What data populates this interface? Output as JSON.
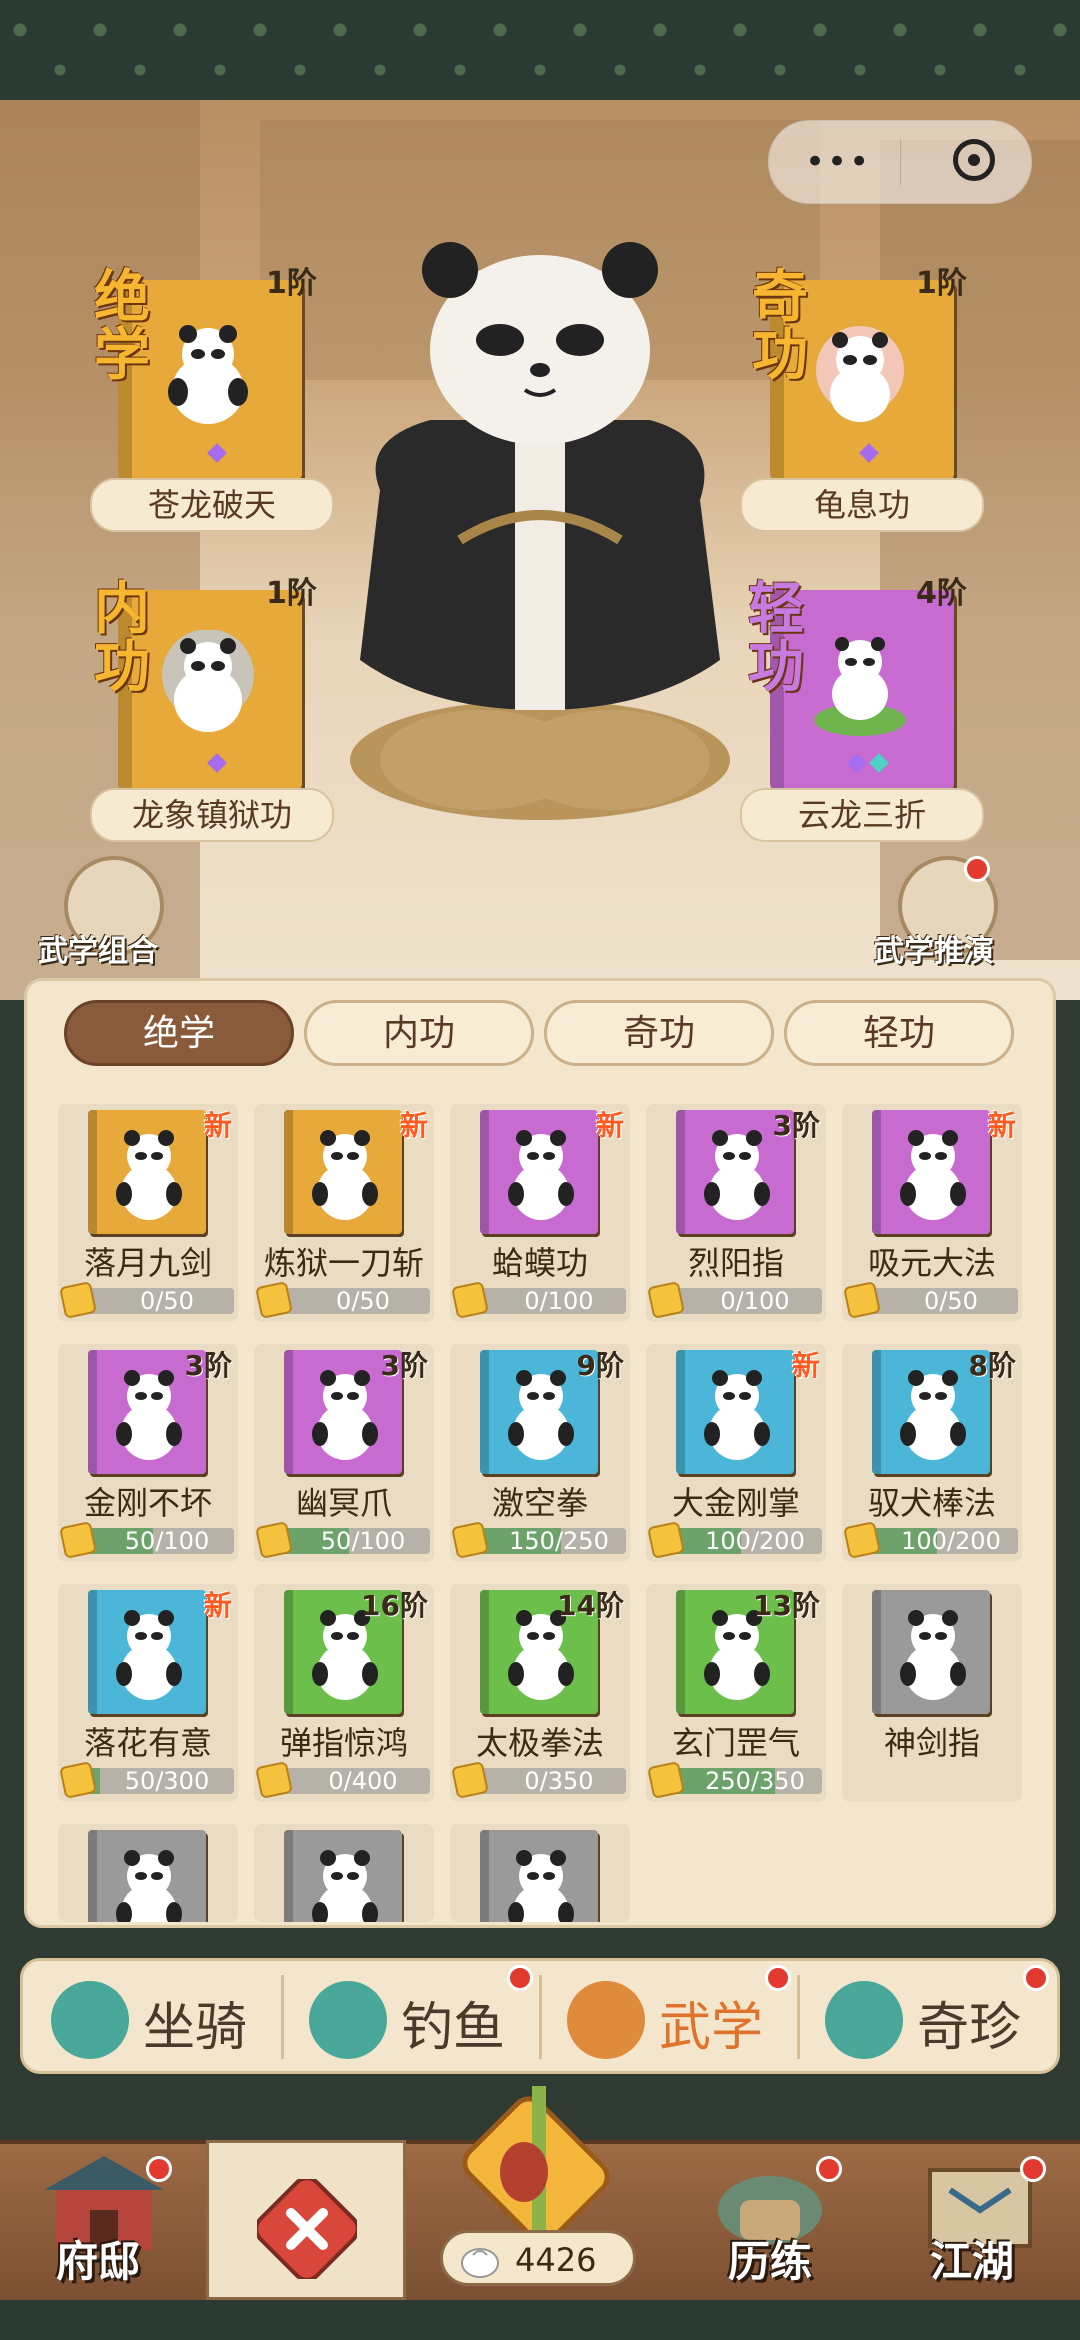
{
  "header": {
    "menu_label": "•••",
    "colors": {
      "band": "#2b3a33",
      "active_tab": "#8a5b3a",
      "new_tag": "#ff5a1f"
    }
  },
  "equipped": [
    {
      "category": "绝学",
      "name": "苍龙破天",
      "tier": "1阶",
      "color": "#e6a93a",
      "gems": [
        "#a66cf0"
      ]
    },
    {
      "category": "奇功",
      "name": "龟息功",
      "tier": "1阶",
      "color": "#e6a93a",
      "gems": [
        "#a66cf0"
      ]
    },
    {
      "category": "内功",
      "name": "龙象镇狱功",
      "tier": "1阶",
      "color": "#e6a93a",
      "gems": [
        "#a66cf0"
      ]
    },
    {
      "category": "轻功",
      "name": "云龙三折",
      "tier": "4阶",
      "color": "#c76bd1",
      "gems": [
        "#a66cf0",
        "#4fd1c5"
      ]
    }
  ],
  "side_buttons": {
    "combo": "武学组合",
    "deduce": "武学推演"
  },
  "tabs": [
    "绝学",
    "内功",
    "奇功",
    "轻功"
  ],
  "active_tab": 0,
  "skills": [
    {
      "name": "落月九剑",
      "tag": "新",
      "tag_type": "new",
      "progress": "0/50",
      "fill": 0.0,
      "color": "#e6a93a"
    },
    {
      "name": "炼狱一刀斩",
      "tag": "新",
      "tag_type": "new",
      "progress": "0/50",
      "fill": 0.0,
      "color": "#e6a93a"
    },
    {
      "name": "蛤蟆功",
      "tag": "新",
      "tag_type": "new",
      "progress": "0/100",
      "fill": 0.0,
      "color": "#c76bd1"
    },
    {
      "name": "烈阳指",
      "tag": "3阶",
      "tag_type": "tier",
      "progress": "0/100",
      "fill": 0.0,
      "color": "#c76bd1"
    },
    {
      "name": "吸元大法",
      "tag": "新",
      "tag_type": "new",
      "progress": "0/50",
      "fill": 0.0,
      "color": "#c76bd1"
    },
    {
      "name": "金刚不坏",
      "tag": "3阶",
      "tag_type": "tier",
      "progress": "50/100",
      "fill": 0.5,
      "color": "#c76bd1"
    },
    {
      "name": "幽冥爪",
      "tag": "3阶",
      "tag_type": "tier",
      "progress": "50/100",
      "fill": 0.5,
      "color": "#c76bd1"
    },
    {
      "name": "激空拳",
      "tag": "9阶",
      "tag_type": "tier",
      "progress": "150/250",
      "fill": 0.6,
      "color": "#4bb6d8"
    },
    {
      "name": "大金刚掌",
      "tag": "新",
      "tag_type": "new",
      "progress": "100/200",
      "fill": 0.5,
      "color": "#4bb6d8"
    },
    {
      "name": "驭犬棒法",
      "tag": "8阶",
      "tag_type": "tier",
      "progress": "100/200",
      "fill": 0.5,
      "color": "#4bb6d8"
    },
    {
      "name": "落花有意",
      "tag": "新",
      "tag_type": "new",
      "progress": "50/300",
      "fill": 0.17,
      "color": "#4bb6d8"
    },
    {
      "name": "弹指惊鸿",
      "tag": "16阶",
      "tag_type": "tier",
      "progress": "0/400",
      "fill": 0.0,
      "color": "#6cbf4a"
    },
    {
      "name": "太极拳法",
      "tag": "14阶",
      "tag_type": "tier",
      "progress": "0/350",
      "fill": 0.0,
      "color": "#6cbf4a"
    },
    {
      "name": "玄门罡气",
      "tag": "13阶",
      "tag_type": "tier",
      "progress": "250/350",
      "fill": 0.71,
      "color": "#6cbf4a"
    },
    {
      "name": "神剑指",
      "tag": "",
      "tag_type": "none",
      "progress": "",
      "fill": 0.0,
      "color": "#9a9a9a"
    },
    {
      "name": "",
      "tag": "",
      "tag_type": "none",
      "progress": "",
      "fill": 0.0,
      "color": "#9a9a9a"
    },
    {
      "name": "",
      "tag": "",
      "tag_type": "none",
      "progress": "",
      "fill": 0.0,
      "color": "#9a9a9a"
    },
    {
      "name": "",
      "tag": "",
      "tag_type": "none",
      "progress": "",
      "fill": 0.0,
      "color": "#9a9a9a"
    }
  ],
  "subnav": [
    {
      "label": "坐骑",
      "icon": "horse-icon",
      "active": false,
      "badge": false
    },
    {
      "label": "钓鱼",
      "icon": "fish-icon",
      "active": false,
      "badge": true
    },
    {
      "label": "武学",
      "icon": "scroll-icon",
      "active": true,
      "badge": true
    },
    {
      "label": "奇珍",
      "icon": "lotus-icon",
      "active": false,
      "badge": true
    }
  ],
  "bottomnav": {
    "home": "府邸",
    "close": "close-icon",
    "currency": "4426",
    "train": "历练",
    "world": "江湖"
  }
}
